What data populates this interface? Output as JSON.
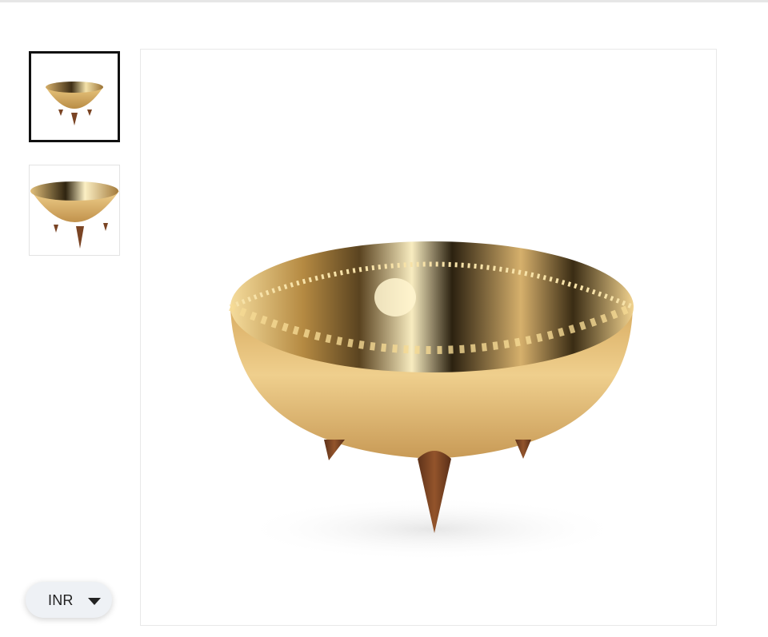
{
  "gallery": {
    "thumbnails": [
      {
        "name": "bowl-view-1",
        "selected": true
      },
      {
        "name": "bowl-view-2",
        "selected": false
      }
    ],
    "main_image": {
      "name": "brass-bowl-with-wooden-legs"
    }
  },
  "currency_selector": {
    "value": "INR",
    "icon": "caret-down-icon"
  },
  "colors": {
    "brass_light": "#f3d58a",
    "brass_mid": "#c9a05a",
    "brass_dark": "#5a4320",
    "wood": "#7a4424",
    "selected_border": "#111111"
  }
}
